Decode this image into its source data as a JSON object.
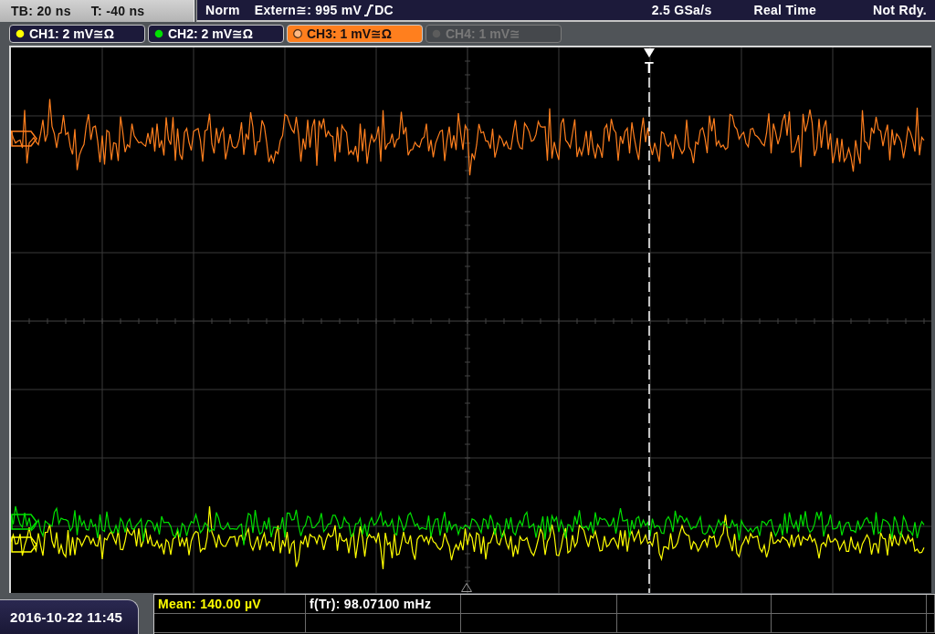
{
  "status_bar": {
    "timebase": "TB: 20 ns",
    "trigger_offset": "T: -40 ns",
    "trigger_mode": "Norm",
    "trigger_source": "Extern≅: 995 mV",
    "coupling": "DC",
    "sample_rate": "2.5 GSa/s",
    "acquisition": "Real Time",
    "state": "Not Rdy."
  },
  "channels": [
    {
      "label": "CH1: 2 mV≅Ω",
      "color": "#ffff00",
      "selected": false,
      "on": true
    },
    {
      "label": "CH2: 2 mV≅Ω",
      "color": "#00e000",
      "selected": false,
      "on": true
    },
    {
      "label": "CH3: 1 mV≅Ω",
      "color": "#ff7f1e",
      "selected": true,
      "on": true
    },
    {
      "label": "CH4: 1 mV≅",
      "color": "#5c5c5c",
      "selected": false,
      "on": false
    }
  ],
  "trigger_marker": {
    "label": "T"
  },
  "date_time": "2016-10-22 11:45",
  "measurements": [
    {
      "text": "Mean: 140.00 µV",
      "color": "#ffff00"
    },
    {
      "text": "f(Tr): 98.07100 mHz",
      "color": "#ffffff"
    }
  ]
}
